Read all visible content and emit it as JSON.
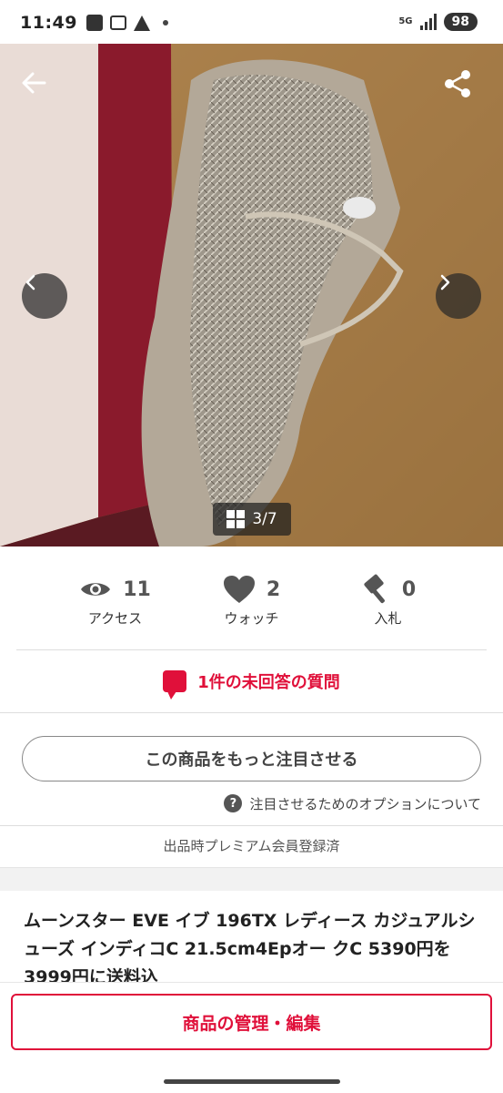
{
  "status_bar": {
    "time": "11:49",
    "network": "5G",
    "battery": "98"
  },
  "gallery": {
    "counter": "3/7"
  },
  "stats": [
    {
      "icon": "eye-icon",
      "count": "11",
      "label": "アクセス"
    },
    {
      "icon": "heart-icon",
      "count": "2",
      "label": "ウォッチ"
    },
    {
      "icon": "gavel-icon",
      "count": "0",
      "label": "入札"
    }
  ],
  "question": {
    "text": "1件の未回答の質問",
    "color": "#e0103a"
  },
  "promote": {
    "button_label": "この商品をもっと注目させる",
    "option_link": "注目させるためのオプションについて",
    "help_glyph": "?"
  },
  "premium_note": "出品時プレミアム会員登録済",
  "product": {
    "title": "ムーンスター EVE イブ 196TX レディース カジュアルシューズ インディコC 21.5cm4Epオー クC 5390円を3999円に送料込"
  },
  "bottom": {
    "manage_label": "商品の管理・編集"
  },
  "colors": {
    "accent": "#e0103a"
  }
}
